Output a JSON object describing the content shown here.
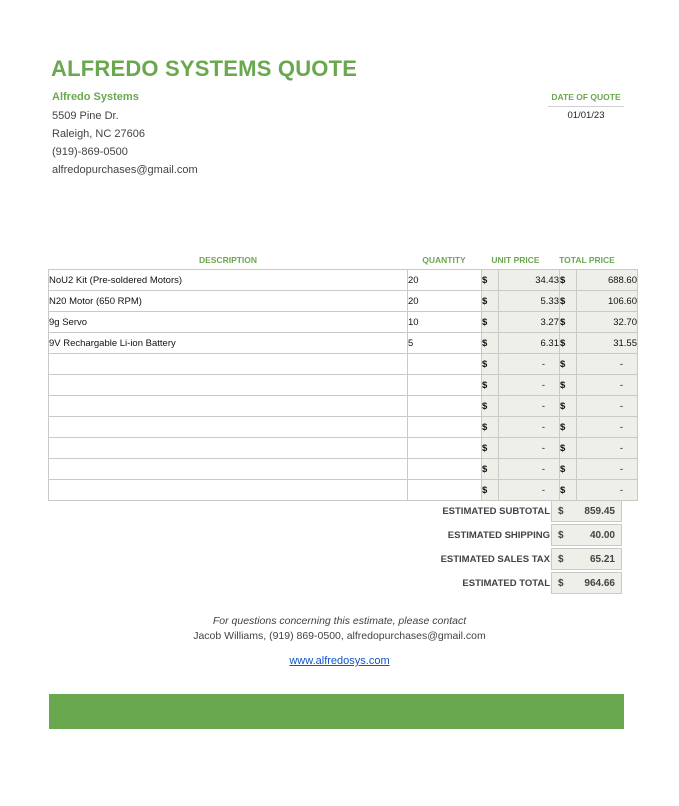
{
  "header": {
    "title": "ALFREDO SYSTEMS QUOTE"
  },
  "company": {
    "name": "Alfredo Systems",
    "street": "5509 Pine Dr.",
    "city": "Raleigh, NC 27606",
    "phone": "(919)-869-0500",
    "email": "alfredopurchases@gmail.com"
  },
  "date": {
    "label": "DATE OF QUOTE",
    "value": "01/01/23"
  },
  "table": {
    "headers": {
      "description": "DESCRIPTION",
      "quantity": "QUANTITY",
      "unit_price": "UNIT PRICE",
      "total_price": "TOTAL PRICE"
    },
    "currency": "$",
    "rows": [
      {
        "description": "NoU2 Kit (Pre-soldered Motors)",
        "quantity": "20",
        "unit_price": "34.43",
        "total_price": "688.60"
      },
      {
        "description": "N20 Motor (650 RPM)",
        "quantity": "20",
        "unit_price": "5.33",
        "total_price": "106.60"
      },
      {
        "description": "9g Servo",
        "quantity": "10",
        "unit_price": "3.27",
        "total_price": "32.70"
      },
      {
        "description": "9V Rechargable Li-ion Battery",
        "quantity": "5",
        "unit_price": "6.31",
        "total_price": "31.55"
      },
      {
        "description": "",
        "quantity": "",
        "unit_price": "-",
        "total_price": "-"
      },
      {
        "description": "",
        "quantity": "",
        "unit_price": "-",
        "total_price": "-"
      },
      {
        "description": "",
        "quantity": "",
        "unit_price": "-",
        "total_price": "-"
      },
      {
        "description": "",
        "quantity": "",
        "unit_price": "-",
        "total_price": "-"
      },
      {
        "description": "",
        "quantity": "",
        "unit_price": "-",
        "total_price": "-"
      },
      {
        "description": "",
        "quantity": "",
        "unit_price": "-",
        "total_price": "-"
      },
      {
        "description": "",
        "quantity": "",
        "unit_price": "-",
        "total_price": "-"
      }
    ]
  },
  "summary": [
    {
      "label": "ESTIMATED SUBTOTAL",
      "currency": "$",
      "value": "859.45"
    },
    {
      "label": "ESTIMATED SHIPPING",
      "currency": "$",
      "value": "40.00"
    },
    {
      "label": "ESTIMATED SALES TAX",
      "currency": "$",
      "value": "65.21"
    },
    {
      "label": "ESTIMATED TOTAL",
      "currency": "$",
      "value": "964.66"
    }
  ],
  "footer": {
    "line1": "For questions concerning this estimate, please contact",
    "line2": "Jacob Williams, (919) 869-0500, alfredopurchases@gmail.com",
    "website": "www.alfredosys.com"
  },
  "colors": {
    "accent": "#6aa84f",
    "cell_shade": "#efefe9",
    "link": "#1155cc"
  }
}
